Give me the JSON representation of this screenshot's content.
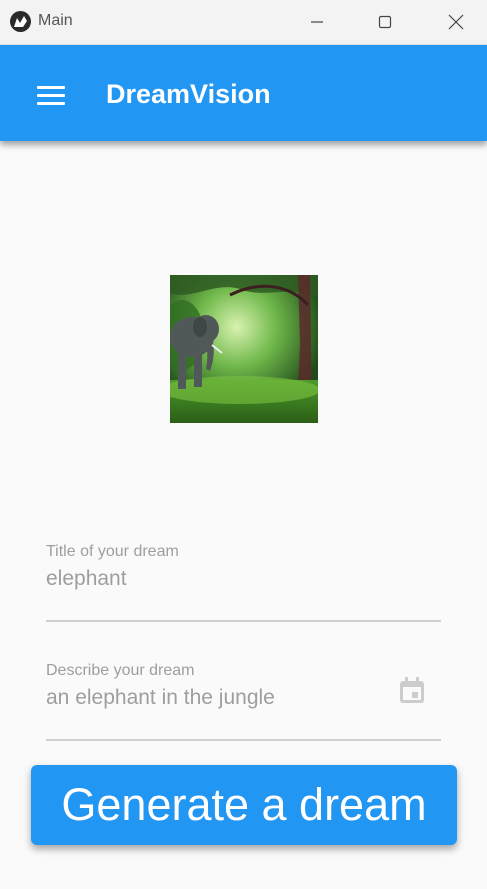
{
  "window": {
    "title": "Main",
    "icon": "kivy-logo-icon",
    "controls": [
      "minimize-icon",
      "maximize-icon",
      "close-icon"
    ]
  },
  "appbar": {
    "title": "DreamVision",
    "menu_icon": "hamburger-menu-icon",
    "background": "#2196f3"
  },
  "image": {
    "subject": "elephant in a green jungle"
  },
  "form": {
    "title_field": {
      "label": "Title of your dream",
      "value": "elephant"
    },
    "description_field": {
      "label": "Describe your dream",
      "value": "an elephant in the jungle",
      "icon": "calendar-icon"
    }
  },
  "generate_button": {
    "label": "Generate a dream"
  },
  "colors": {
    "accent": "#2196f3",
    "background": "#fafafa",
    "hint_text": "#9e9e9e",
    "underline": "#cfcfcf"
  }
}
